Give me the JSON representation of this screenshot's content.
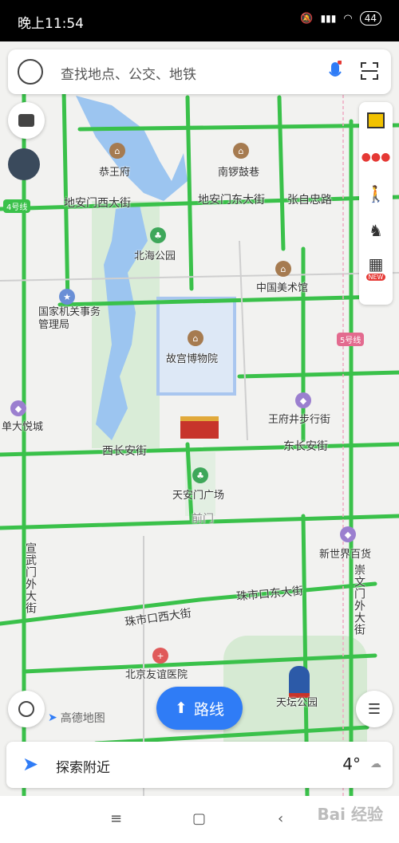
{
  "status": {
    "time": "晚上11:54",
    "battery": "44",
    "net": "HD"
  },
  "search": {
    "placeholder": "查找地点、公交、地铁"
  },
  "map": {
    "pois": {
      "gongwangfu": "恭王府",
      "nanluoguxiang": "南锣鼓巷",
      "beihai": "北海公园",
      "meishuguan": "中国美术馆",
      "guojiajiguan": "国家机关事务管理局",
      "gugong": "故宫博物院",
      "xidanjoy": "单大悦城",
      "wangfujing": "王府井步行街",
      "tiananmen": "天安门广场",
      "newworld": "新世界百货",
      "youyi": "北京友谊医院",
      "tiantan": "天坛公园"
    },
    "roads": {
      "dianmen_w": "地安门西大街",
      "dianmen_e": "地安门东大街",
      "zhangzizhong": "张自忠路",
      "xichangan": "西长安街",
      "dongchangan": "东长安街",
      "qianmen": "前门",
      "xuanwumen": "宣武门外大街",
      "chongwenmen": "崇文门外大街",
      "zhushikou_w": "珠市口西大街",
      "zhushikou_e": "珠市口东大街"
    },
    "lines": {
      "line4": "4号线",
      "line5": "5号线"
    }
  },
  "toolbar": {
    "new_badge": "NEW"
  },
  "route_button": "路线",
  "logo": "高德地图",
  "bottom": {
    "explore": "探索附近",
    "temp": "4°"
  },
  "watermark": "Bai 经验"
}
